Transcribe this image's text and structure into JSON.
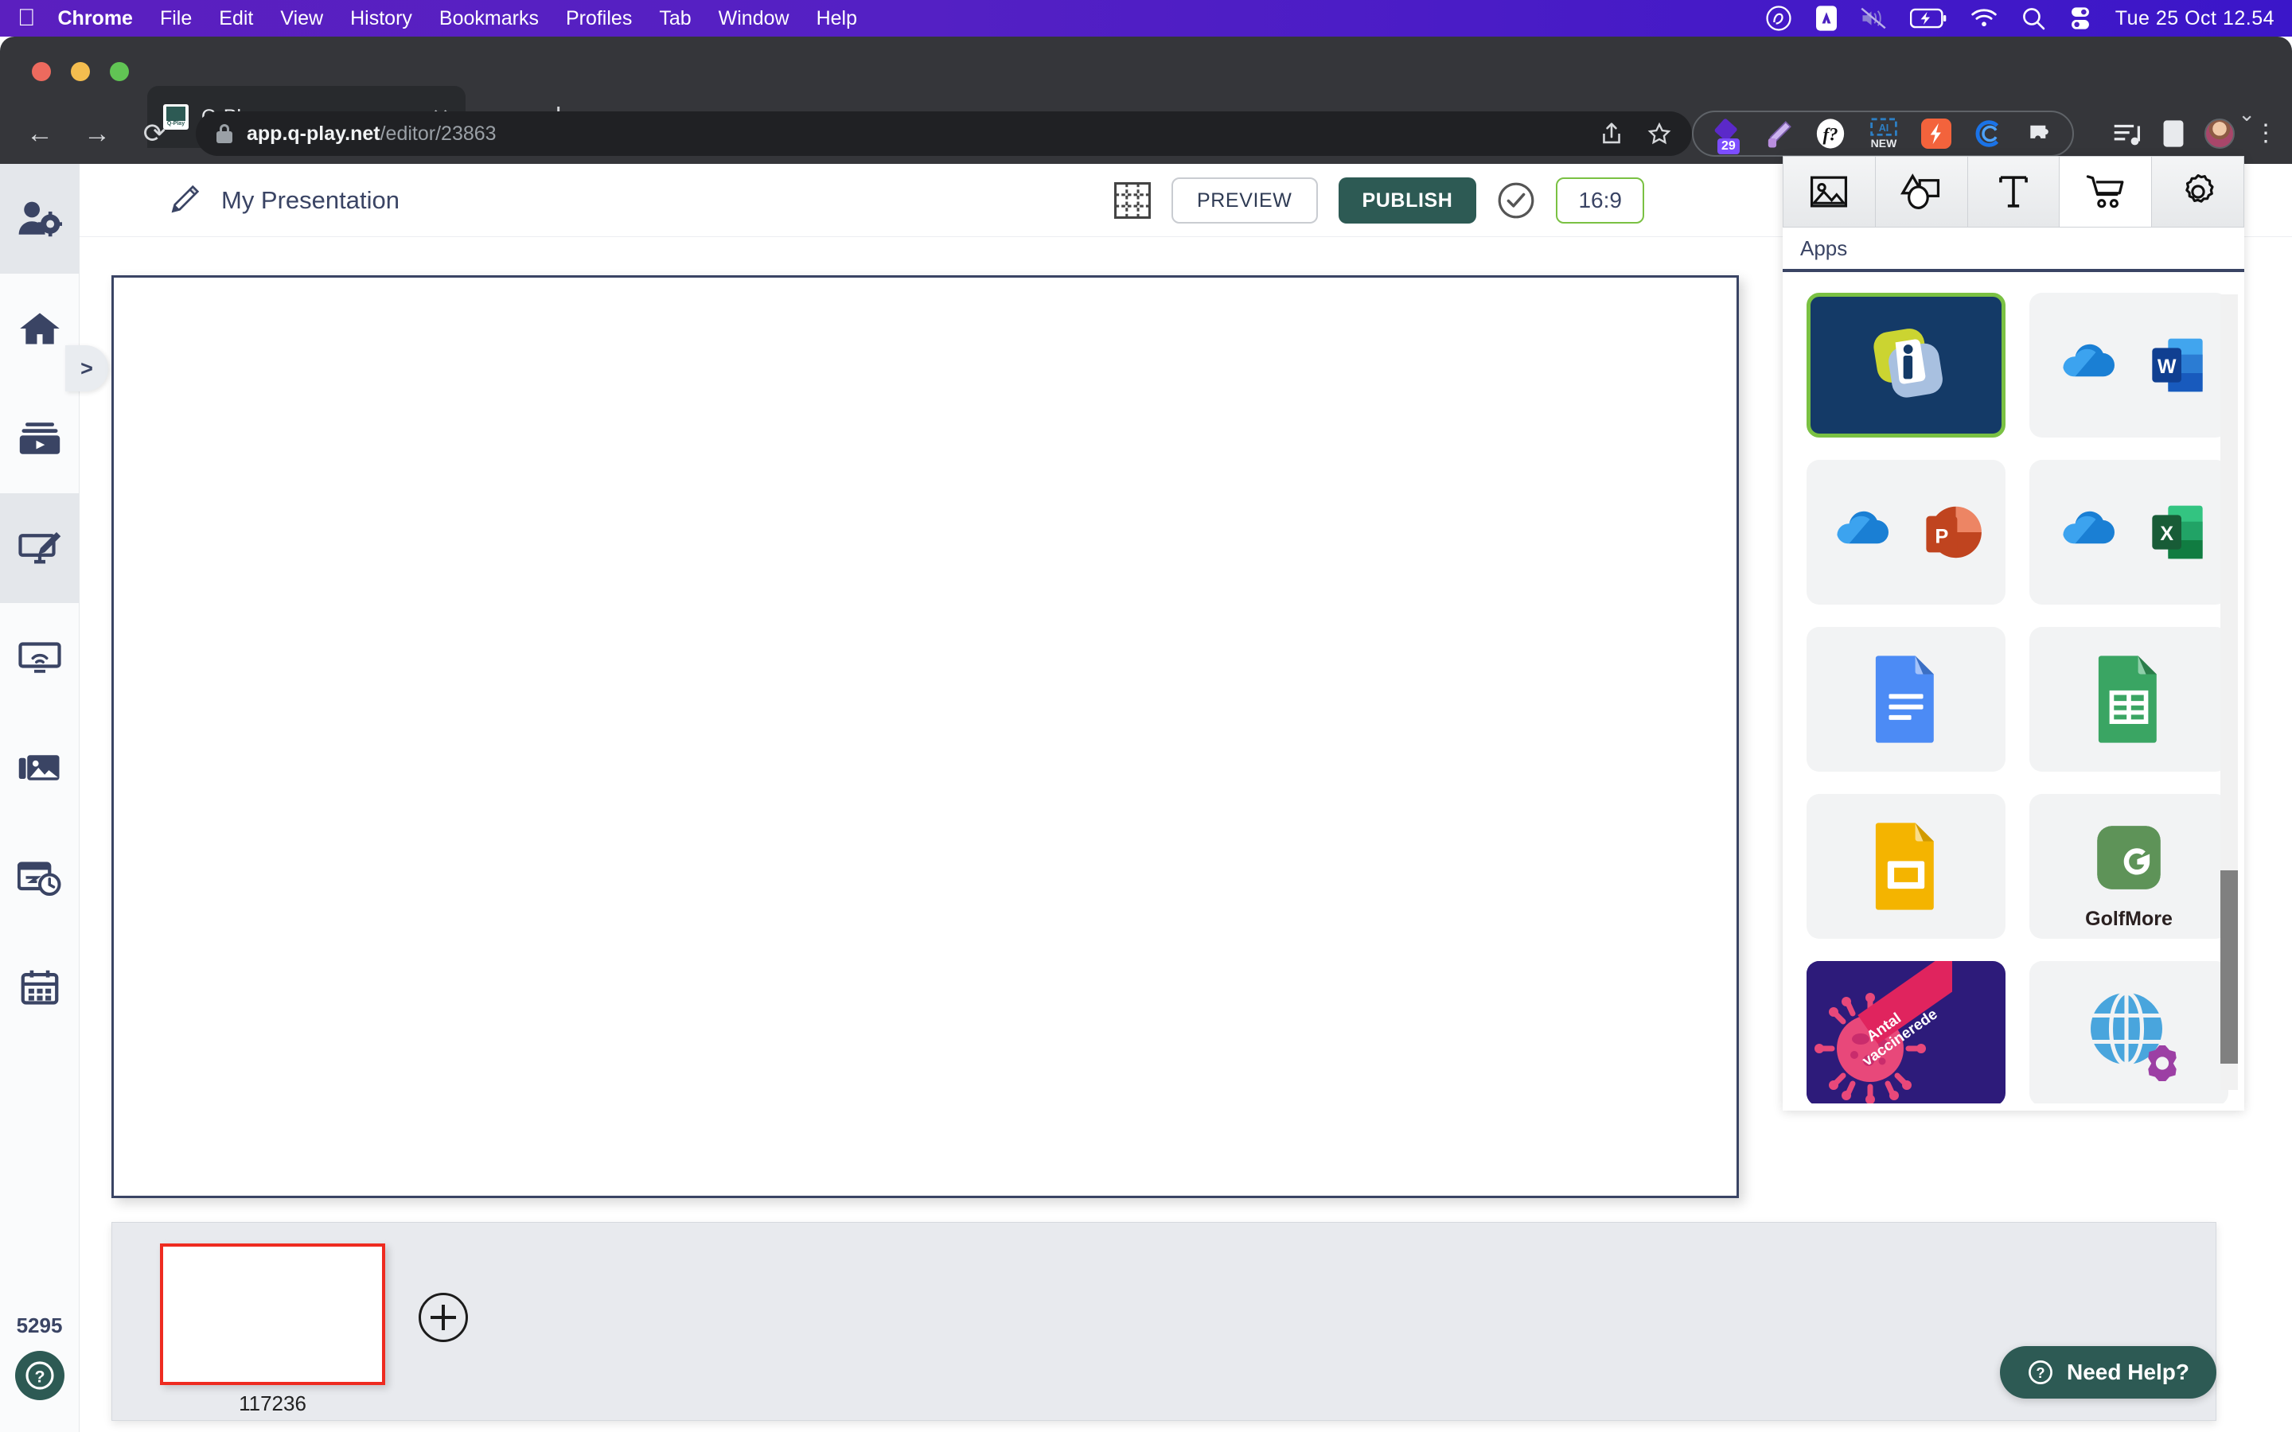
{
  "os_menubar": {
    "apple_logo": "apple-icon",
    "items": [
      {
        "label": "Chrome",
        "bold": true
      },
      {
        "label": "File",
        "bold": false
      },
      {
        "label": "Edit",
        "bold": false
      },
      {
        "label": "View",
        "bold": false
      },
      {
        "label": "History",
        "bold": false
      },
      {
        "label": "Bookmarks",
        "bold": false
      },
      {
        "label": "Profiles",
        "bold": false
      },
      {
        "label": "Tab",
        "bold": false
      },
      {
        "label": "Window",
        "bold": false
      },
      {
        "label": "Help",
        "bold": false
      }
    ],
    "status_icons": [
      "creative-cloud-icon",
      "adobe-icon",
      "speaker-muted-icon",
      "battery-charging-icon",
      "wifi-icon",
      "search-icon",
      "control-center-icon"
    ],
    "clock": "Tue 25 Oct  12.54",
    "background_color": "#5420c4"
  },
  "browser": {
    "tab": {
      "title": "Q-Play",
      "favicon_label": "Q-Play",
      "close_label": "✕"
    },
    "new_tab_label": "+",
    "tab_list_chevron": "⌄",
    "nav": {
      "back": "←",
      "forward": "→",
      "reload": "⟳"
    },
    "omnibox": {
      "host": "app.q-play.net",
      "path": "/editor/23863",
      "lock": "lock-icon"
    },
    "share_icon": "share-icon",
    "bookmark_icon": "star-icon",
    "extensions": [
      {
        "name": "purple-diamond-extension-icon",
        "badge": "29"
      },
      {
        "name": "pen-extension-icon",
        "badge": ""
      },
      {
        "name": "f-question-extension-icon",
        "badge": ""
      },
      {
        "name": "new-ai-extension-icon",
        "badge": "NEW"
      },
      {
        "name": "orange-lightning-extension-icon",
        "badge": ""
      },
      {
        "name": "blue-c-extension-icon",
        "badge": ""
      },
      {
        "name": "puzzle-extension-icon",
        "badge": ""
      }
    ],
    "media_icon": "music-list-icon",
    "sidepanel_icon": "side-panel-icon",
    "avatar": "user-avatar",
    "menu_icon": "kebab-menu-icon"
  },
  "sidebar": {
    "toggle_label": ">",
    "items": [
      {
        "name": "user-settings",
        "active": true
      },
      {
        "name": "home",
        "active": false
      },
      {
        "name": "media-library",
        "active": false
      },
      {
        "name": "design-editor",
        "active": true
      },
      {
        "name": "screen-cast",
        "active": false
      },
      {
        "name": "image-gallery",
        "active": false
      },
      {
        "name": "schedule-clock",
        "active": false
      },
      {
        "name": "calendar",
        "active": false
      }
    ],
    "account_number": "5295",
    "help_icon": "question-mark-icon"
  },
  "header": {
    "edit_icon": "pencil-icon",
    "title": "My Presentation",
    "grid_icon": "grid-layout-icon",
    "preview_label": "PREVIEW",
    "publish_label": "PUBLISH",
    "status_icon": "check-circle-icon",
    "aspect_ratio": "16:9",
    "accent_green": "#2d5a54",
    "border_green": "#7ac143"
  },
  "canvas": {
    "border_color": "#3a4464",
    "background": "#ffffff"
  },
  "filmstrip": {
    "slides": [
      {
        "label": "117236",
        "selected": true,
        "selection_color": "#ee2b20"
      }
    ],
    "add_slide_label": "+"
  },
  "need_help": {
    "icon": "question-circle-icon",
    "label": "Need Help?"
  },
  "right_panel": {
    "tabs": [
      {
        "name": "images-tab",
        "icon": "image-icon",
        "active": false
      },
      {
        "name": "shapes-tab",
        "icon": "shapes-icon",
        "active": false
      },
      {
        "name": "text-tab",
        "icon": "text-t-icon",
        "active": false
      },
      {
        "name": "apps-tab",
        "icon": "shopping-cart-icon",
        "active": true
      },
      {
        "name": "settings-tab",
        "icon": "gear-icon",
        "active": false
      }
    ],
    "section_label": "Apps",
    "apps": [
      {
        "name": "infowide-app",
        "label": "",
        "selected": true
      },
      {
        "name": "onedrive-word-app",
        "label": "",
        "selected": false
      },
      {
        "name": "onedrive-powerpoint-app",
        "label": "",
        "selected": false
      },
      {
        "name": "onedrive-excel-app",
        "label": "",
        "selected": false
      },
      {
        "name": "google-docs-app",
        "label": "",
        "selected": false
      },
      {
        "name": "google-sheets-app",
        "label": "",
        "selected": false
      },
      {
        "name": "google-slides-app",
        "label": "",
        "selected": false
      },
      {
        "name": "golfmore-app",
        "label": "GolfMore",
        "selected": false
      },
      {
        "name": "covid-vaccine-app",
        "label": "Antal vaccinerede",
        "selected": false
      },
      {
        "name": "web-globe-app",
        "label": "",
        "selected": false
      }
    ]
  }
}
